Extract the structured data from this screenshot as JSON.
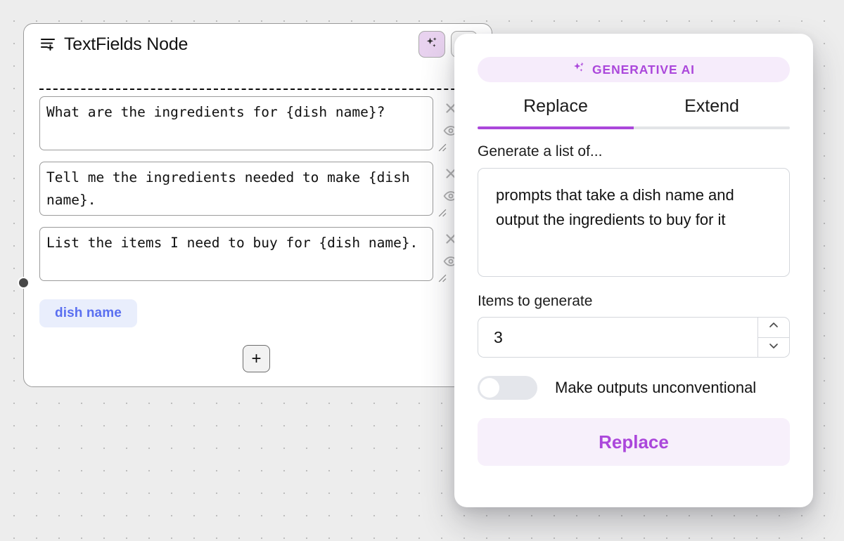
{
  "canvas": {
    "background_color": "#ededed",
    "dot_color": "#b9b9b9"
  },
  "node": {
    "title": "TextFields Node",
    "icon": "list-plus-icon",
    "header_buttons": [
      {
        "name": "generative-ai-toggle",
        "icon": "sparkle-icon",
        "active": true
      },
      {
        "name": "secondary-action",
        "icon": "chevron-left-icon",
        "active": false
      }
    ],
    "fields": [
      {
        "value": "What are the ingredients for {dish name}?",
        "remove_icon": "close-icon",
        "visibility_icon": "eye-icon"
      },
      {
        "value": "Tell me the ingredients needed to make {dish name}.",
        "remove_icon": "close-icon",
        "visibility_icon": "eye-icon"
      },
      {
        "value": "List the items I need to buy for {dish name}.",
        "remove_icon": "close-icon",
        "visibility_icon": "eye-icon"
      }
    ],
    "variable_chip": "dish name",
    "variable_chip_color": "#5a6ff0",
    "add_field_label": "+"
  },
  "panel": {
    "badge": {
      "label": "GENERATIVE AI",
      "icon": "sparkle-icon",
      "color": "#ab47db",
      "background": "#f6ecfb"
    },
    "tabs": [
      {
        "label": "Replace",
        "active": true
      },
      {
        "label": "Extend",
        "active": false
      }
    ],
    "accent_color": "#ab47db",
    "prompt": {
      "label": "Generate a list of...",
      "value": "prompts that take a dish name and output the ingredients to buy for it"
    },
    "items": {
      "label": "Items to generate",
      "value": "3",
      "increment_icon": "chevron-up-icon",
      "decrement_icon": "chevron-down-icon"
    },
    "toggle": {
      "label": "Make outputs unconventional",
      "enabled": false
    },
    "submit": {
      "label": "Replace"
    }
  }
}
